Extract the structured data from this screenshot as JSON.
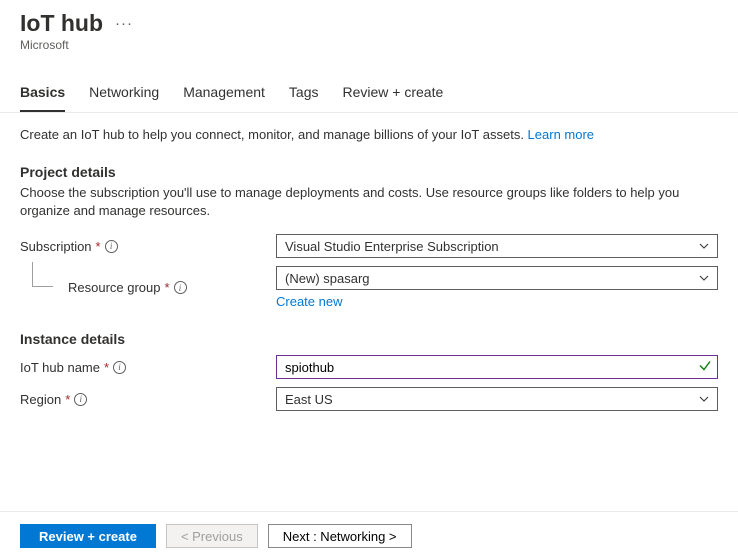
{
  "header": {
    "title": "IoT hub",
    "subtitle": "Microsoft"
  },
  "tabs": [
    {
      "label": "Basics",
      "active": true
    },
    {
      "label": "Networking",
      "active": false
    },
    {
      "label": "Management",
      "active": false
    },
    {
      "label": "Tags",
      "active": false
    },
    {
      "label": "Review + create",
      "active": false
    }
  ],
  "intro": {
    "text": "Create an IoT hub to help you connect, monitor, and manage billions of your IoT assets.  ",
    "learn_more": "Learn more"
  },
  "project_details": {
    "title": "Project details",
    "desc": "Choose the subscription you'll use to manage deployments and costs. Use resource groups like folders to help you organize and manage resources.",
    "subscription_label": "Subscription",
    "subscription_value": "Visual Studio Enterprise Subscription",
    "resource_group_label": "Resource group",
    "resource_group_value": "(New) spasarg",
    "create_new": "Create new"
  },
  "instance_details": {
    "title": "Instance details",
    "name_label": "IoT hub name",
    "name_value": "spiothub",
    "region_label": "Region",
    "region_value": "East US"
  },
  "footer": {
    "review": "Review + create",
    "previous": "< Previous",
    "next": "Next : Networking >"
  }
}
